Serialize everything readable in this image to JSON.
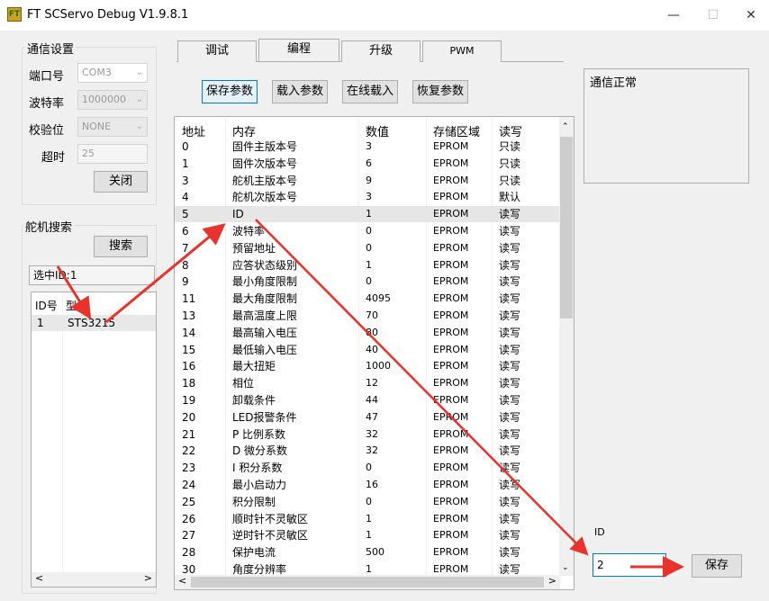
{
  "window": {
    "icon_text": "FT",
    "title": "FT SCServo Debug V1.9.8.1",
    "min": "—",
    "max": "☐",
    "close": "✕"
  },
  "comm": {
    "group_label": "通信设置",
    "port_label": "端口号",
    "port_value": "COM3",
    "baud_label": "波特率",
    "baud_value": "1000000",
    "parity_label": "校验位",
    "parity_value": "NONE",
    "timeout_label": "超时",
    "timeout_value": "25",
    "close_button": "关闭"
  },
  "search": {
    "group_label": "舵机搜索",
    "search_button": "搜索",
    "selected_id": "选中ID:1",
    "columns": [
      "ID号",
      "型号"
    ],
    "rows": [
      {
        "id": "1",
        "model": "STS3215"
      }
    ]
  },
  "tabs": [
    "调试",
    "编程",
    "升级",
    "PWM"
  ],
  "toolbar": {
    "save": "保存参数",
    "load": "载入参数",
    "online": "在线载入",
    "restore": "恢复参数"
  },
  "table": {
    "headers": [
      "地址",
      "内存",
      "数值",
      "存储区域",
      "读写"
    ],
    "selected_row": 4,
    "rows": [
      [
        "0",
        "固件主版本号",
        "3",
        "EPROM",
        "只读"
      ],
      [
        "1",
        "固件次版本号",
        "6",
        "EPROM",
        "只读"
      ],
      [
        "3",
        "舵机主版本号",
        "9",
        "EPROM",
        "只读"
      ],
      [
        "4",
        "舵机次版本号",
        "3",
        "EPROM",
        "默认"
      ],
      [
        "5",
        "ID",
        "1",
        "EPROM",
        "读写"
      ],
      [
        "6",
        "波特率",
        "0",
        "EPROM",
        "读写"
      ],
      [
        "7",
        "预留地址",
        "0",
        "EPROM",
        "读写"
      ],
      [
        "8",
        "应答状态级别",
        "1",
        "EPROM",
        "读写"
      ],
      [
        "9",
        "最小角度限制",
        "0",
        "EPROM",
        "读写"
      ],
      [
        "11",
        "最大角度限制",
        "4095",
        "EPROM",
        "读写"
      ],
      [
        "13",
        "最高温度上限",
        "70",
        "EPROM",
        "读写"
      ],
      [
        "14",
        "最高输入电压",
        "80",
        "EPROM",
        "读写"
      ],
      [
        "15",
        "最低输入电压",
        "40",
        "EPROM",
        "读写"
      ],
      [
        "16",
        "最大扭矩",
        "1000",
        "EPROM",
        "读写"
      ],
      [
        "18",
        "相位",
        "12",
        "EPROM",
        "读写"
      ],
      [
        "19",
        "卸载条件",
        "44",
        "EPROM",
        "读写"
      ],
      [
        "20",
        "LED报警条件",
        "47",
        "EPROM",
        "读写"
      ],
      [
        "21",
        "P 比例系数",
        "32",
        "EPROM",
        "读写"
      ],
      [
        "22",
        "D 微分系数",
        "32",
        "EPROM",
        "读写"
      ],
      [
        "23",
        "I 积分系数",
        "0",
        "EPROM",
        "读写"
      ],
      [
        "24",
        "最小启动力",
        "16",
        "EPROM",
        "读写"
      ],
      [
        "25",
        "积分限制",
        "0",
        "EPROM",
        "读写"
      ],
      [
        "26",
        "顺时针不灵敏区",
        "1",
        "EPROM",
        "读写"
      ],
      [
        "27",
        "逆时针不灵敏区",
        "1",
        "EPROM",
        "读写"
      ],
      [
        "28",
        "保护电流",
        "500",
        "EPROM",
        "读写"
      ],
      [
        "30",
        "角度分辨率",
        "1",
        "EPROM",
        "读写"
      ]
    ]
  },
  "status": {
    "text": "通信正常"
  },
  "edit": {
    "label": "ID",
    "value": "2",
    "save_button": "保存"
  },
  "annotation_color": "#e8322b"
}
